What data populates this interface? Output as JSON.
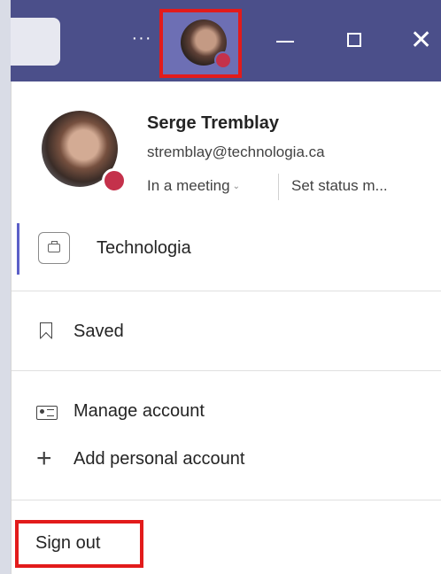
{
  "titlebar": {
    "more_icon": "more-dots-icon",
    "more_text": "···",
    "close_text": "✕"
  },
  "profile": {
    "name": "Serge Tremblay",
    "email": "stremblay@technologia.ca",
    "status": "In a meeting",
    "set_status": "Set status m...",
    "presence_color": "#c4314b"
  },
  "org": {
    "name": "Technologia",
    "icon": "briefcase-icon"
  },
  "menu": {
    "saved": "Saved",
    "manage_account": "Manage account",
    "add_personal": "Add personal account",
    "sign_out": "Sign out"
  },
  "colors": {
    "titlebar": "#4b4f8a",
    "accent": "#5b5fc7",
    "highlight_box": "#e21b1b"
  }
}
